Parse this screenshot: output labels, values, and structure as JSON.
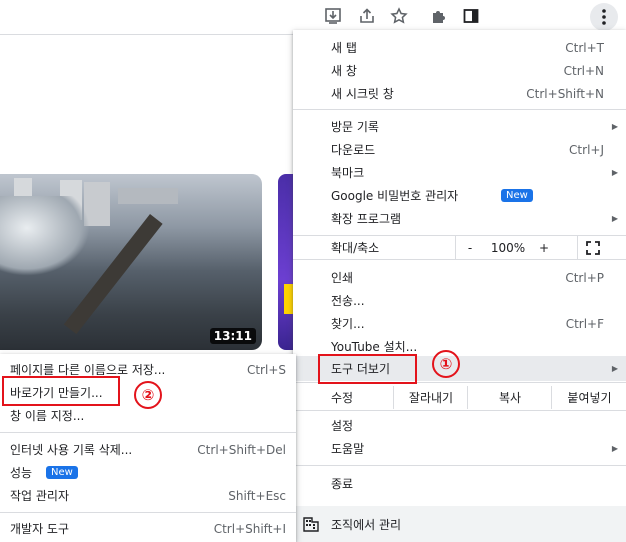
{
  "main_menu": {
    "items_group1": [
      {
        "label": "새 탭",
        "shortcut": "Ctrl+T"
      },
      {
        "label": "새 창",
        "shortcut": "Ctrl+N"
      },
      {
        "label": "새 시크릿 창",
        "shortcut": "Ctrl+Shift+N"
      }
    ],
    "items_group2": [
      {
        "label": "방문 기록",
        "shortcut": ""
      },
      {
        "label": "다운로드",
        "shortcut": "Ctrl+J"
      },
      {
        "label": "북마크",
        "shortcut": ""
      },
      {
        "label": "Google 비밀번호 관리자",
        "shortcut": ""
      },
      {
        "label": "확장 프로그램",
        "shortcut": ""
      }
    ],
    "new_badge": "New",
    "zoom": {
      "label": "확대/축소",
      "minus": "-",
      "value": "100%",
      "plus": "+"
    },
    "items_group3": [
      {
        "label": "인쇄",
        "shortcut": "Ctrl+P"
      },
      {
        "label": "전송...",
        "shortcut": ""
      },
      {
        "label": "찾기...",
        "shortcut": "Ctrl+F"
      },
      {
        "label": "YouTube 설치...",
        "shortcut": ""
      },
      {
        "label": "도구 더보기",
        "shortcut": ""
      }
    ],
    "edit": {
      "label": "수정",
      "cut": "잘라내기",
      "copy": "복사",
      "paste": "붙여넣기"
    },
    "items_group4": [
      {
        "label": "설정"
      },
      {
        "label": "도움말"
      }
    ],
    "exit": "종료",
    "managed": "조직에서 관리"
  },
  "sub_menu": {
    "items": [
      {
        "label": "페이지를 다른 이름으로 저장...",
        "shortcut": "Ctrl+S"
      },
      {
        "label": "바로가기 만들기...",
        "shortcut": ""
      },
      {
        "label": "창 이름 지정...",
        "shortcut": ""
      },
      {
        "label": "인터넷 사용 기록 삭제...",
        "shortcut": "Ctrl+Shift+Del"
      },
      {
        "label": "성능",
        "shortcut": ""
      },
      {
        "label": "작업 관리자",
        "shortcut": "Shift+Esc"
      },
      {
        "label": "개발자 도구",
        "shortcut": "Ctrl+Shift+I"
      }
    ],
    "new_badge": "New"
  },
  "video": {
    "duration": "13:11"
  },
  "annotations": {
    "step1": "①",
    "step2": "②"
  },
  "colors": {
    "accent": "#1a73e8",
    "annotation": "#e3131b",
    "highlight": "#e8eaed"
  }
}
